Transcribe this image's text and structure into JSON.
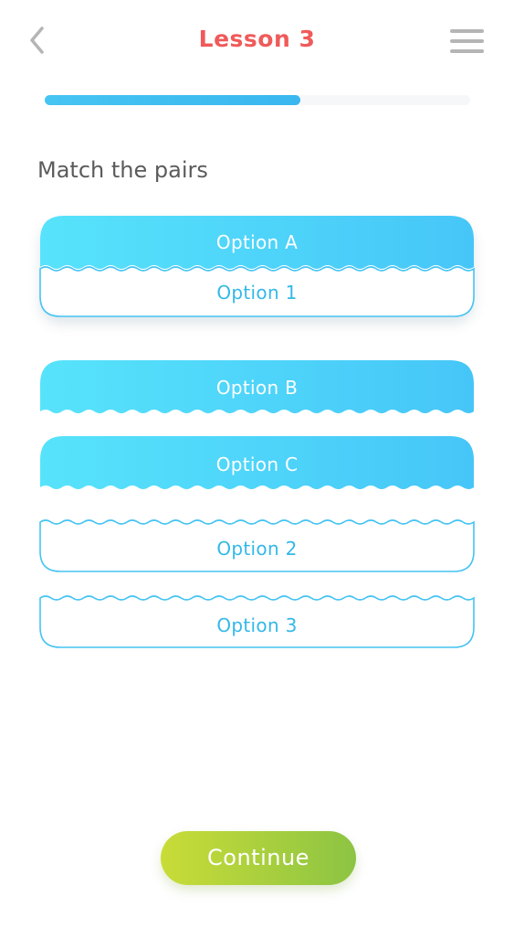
{
  "header": {
    "title": "Lesson 3",
    "back_icon": "chevron-left-icon",
    "menu_icon": "hamburger-menu-icon"
  },
  "progress": {
    "fraction": 0.6
  },
  "instruction": "Match the pairs",
  "pairs": [
    {
      "left": "Option A",
      "right": "Option 1",
      "matched": true
    }
  ],
  "unmatched_left": [
    "Option B",
    "Option C"
  ],
  "unmatched_right": [
    "Option 2",
    "Option 3"
  ],
  "continue_label": "Continue",
  "colors": {
    "title": "#f05a5a",
    "accent_blue": "#46c6f8",
    "accent_blue_light": "#57e3fb",
    "option_text": "#35b8e9",
    "icon_gray": "#b5b5b5",
    "progress_track": "#f6f7f9",
    "continue_start": "#c9dc38",
    "continue_end": "#8cc443",
    "instruction_text": "#5b5b5b"
  }
}
